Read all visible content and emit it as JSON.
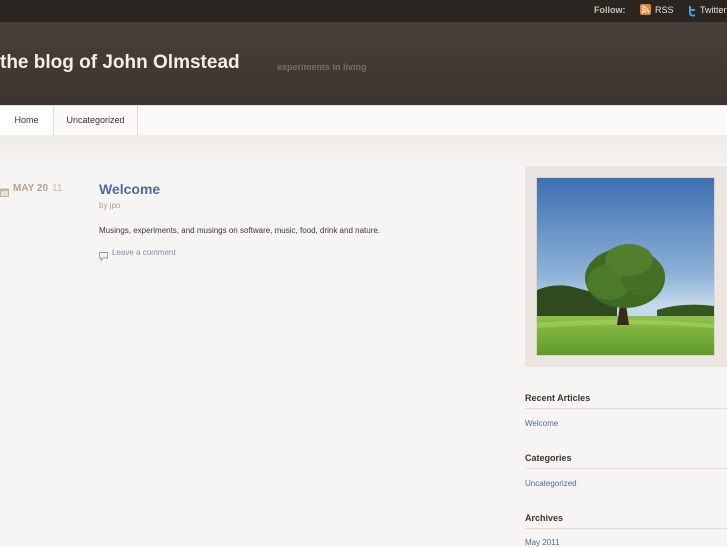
{
  "topbar": {
    "follow_label": "Follow:",
    "links": [
      {
        "label": "RSS",
        "icon": "rss-icon",
        "color": "#e8842a"
      },
      {
        "label": "Twitter",
        "icon": "twitter-icon",
        "color": "#3fa9d6"
      }
    ]
  },
  "header": {
    "title": "the blog of John Olmstead",
    "tagline": "experiments in living"
  },
  "nav": {
    "items": [
      {
        "label": "Home",
        "active": true
      },
      {
        "label": "Uncategorized",
        "active": false
      }
    ]
  },
  "post": {
    "date_month": "MAY 20",
    "date_year": "11",
    "title": "Welcome",
    "author": "by jpo",
    "body": "Musings, experiments, and musings on software, music, food, drink and nature.",
    "comment_link": "Leave a comment"
  },
  "sidebar": {
    "recent_articles": {
      "title": "Recent Articles",
      "items": [
        "Welcome"
      ]
    },
    "categories": {
      "title": "Categories",
      "items": [
        "Uncategorized"
      ]
    },
    "archives": {
      "title": "Archives",
      "items": [
        "May 2011"
      ]
    }
  },
  "colors": {
    "accent_link": "#4d6b9f",
    "header_bg": "#3b3430",
    "topbar_bg": "#2b2522"
  }
}
